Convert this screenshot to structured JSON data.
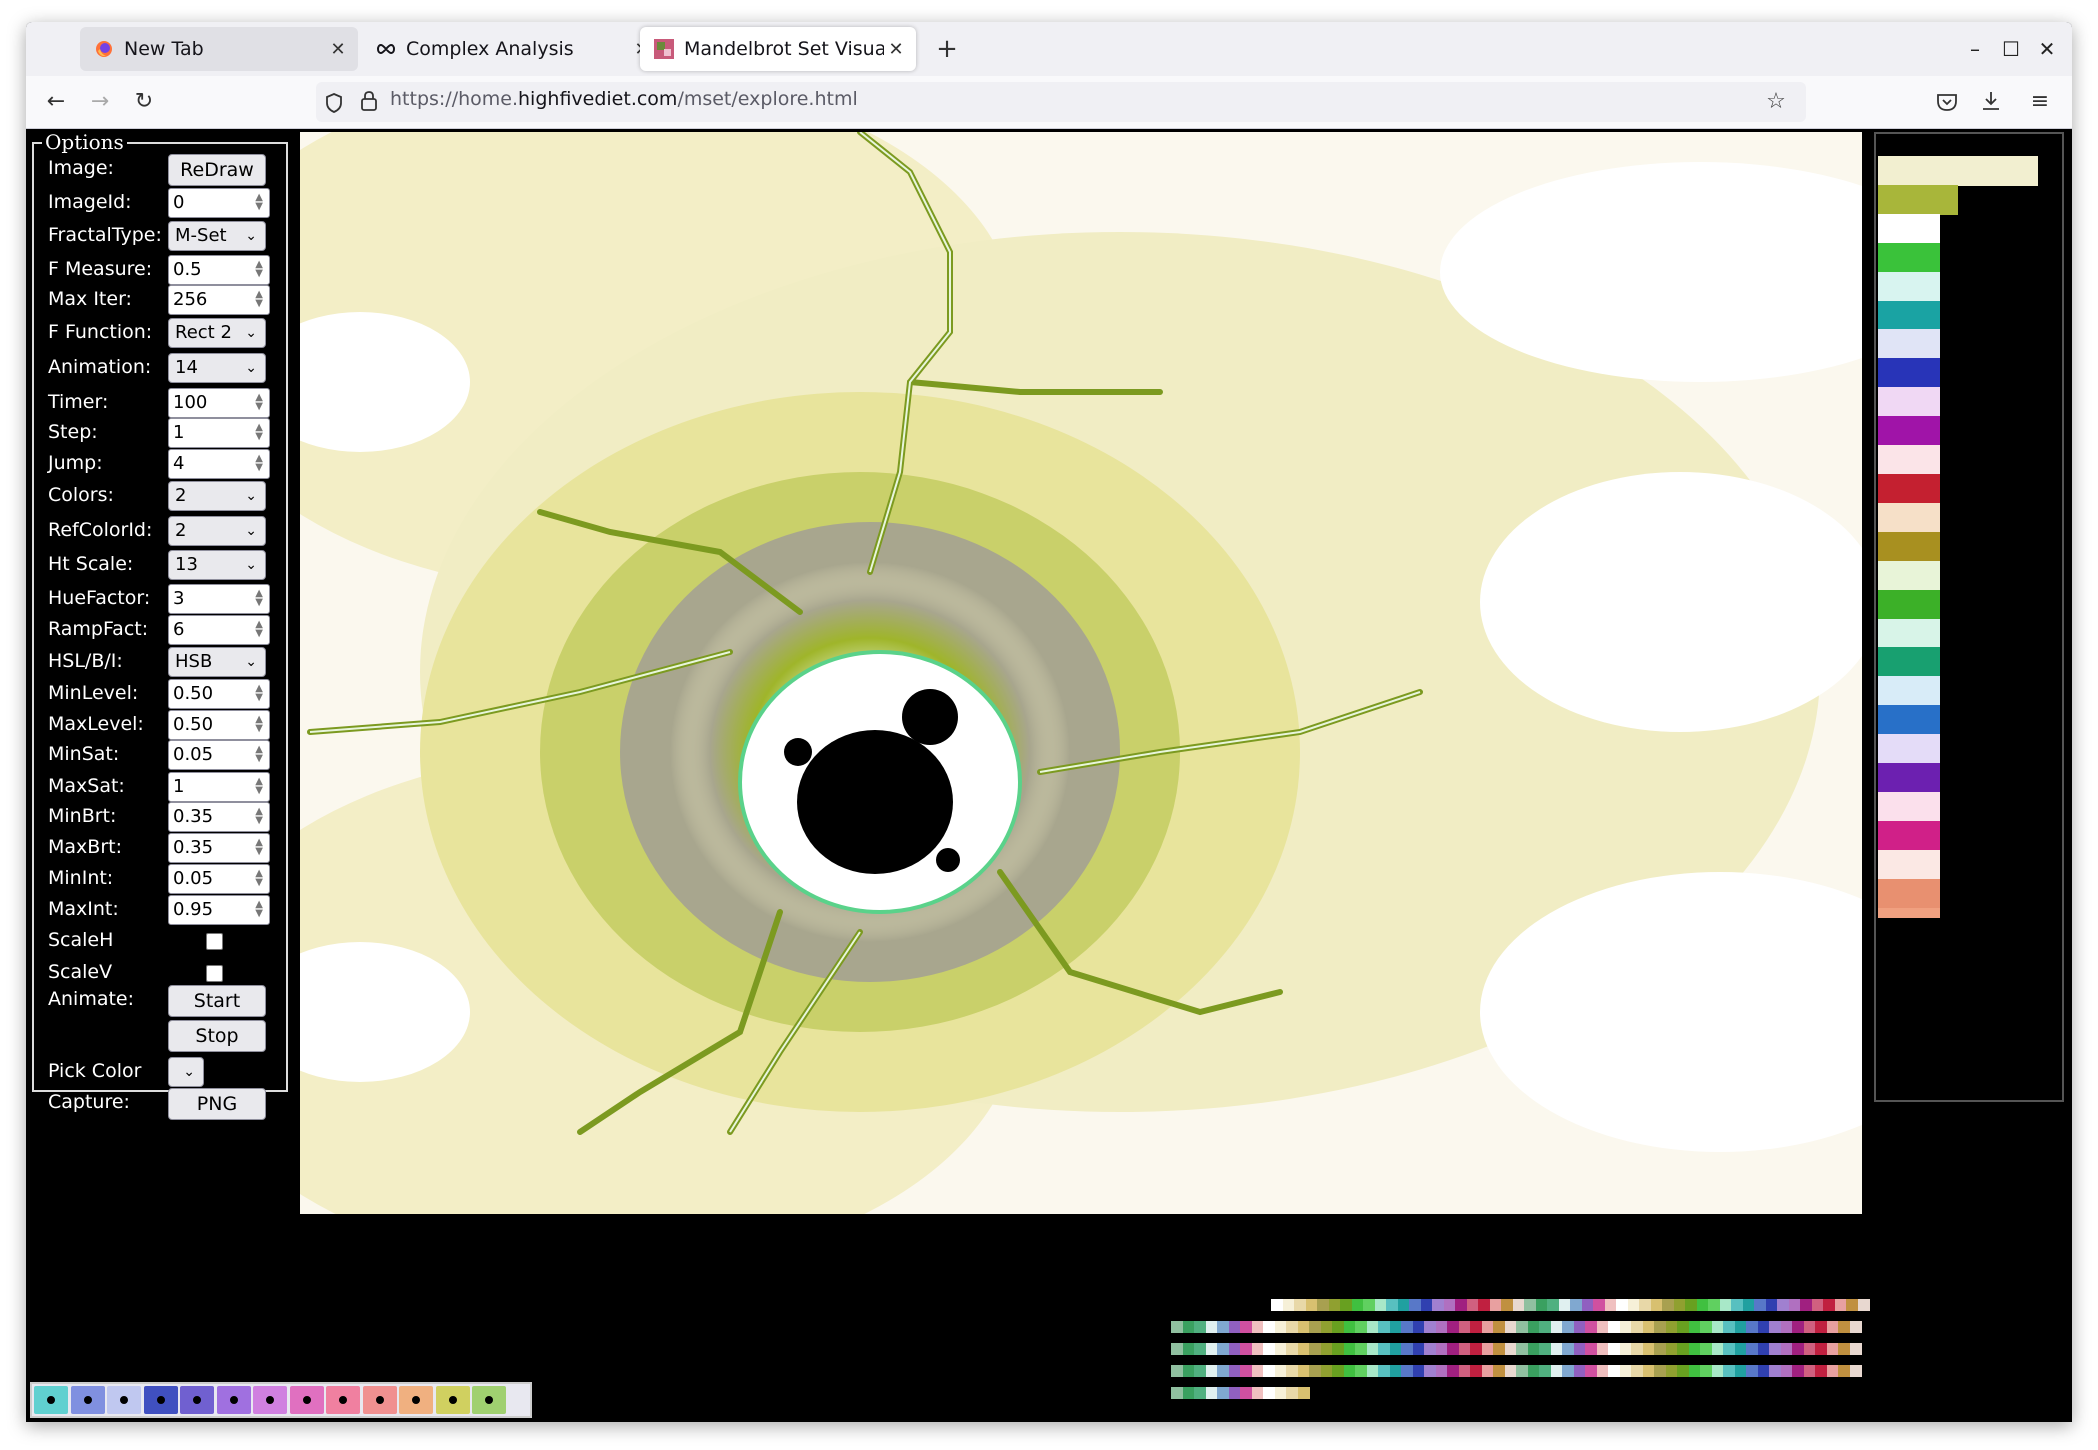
{
  "browser": {
    "tabs": [
      {
        "label": "New Tab",
        "icon": "firefox-icon"
      },
      {
        "label": "Complex Analysis",
        "icon": "infinity-icon"
      },
      {
        "label": "Mandelbrot Set Visualiza",
        "icon": "fractal-favicon-icon",
        "active": true
      }
    ],
    "url_prefix": "https://home.",
    "url_domain": "highfivediet.com",
    "url_path": "/mset/explore.html"
  },
  "options": {
    "legend": "Options",
    "rows": [
      {
        "label": "Image:",
        "kind": "button",
        "value": "ReDraw"
      },
      {
        "label": "ImageId:",
        "kind": "number",
        "value": "0"
      },
      {
        "label": "FractalType:",
        "kind": "select",
        "value": "M-Set"
      },
      {
        "label": "F Measure:",
        "kind": "number",
        "value": "0.5"
      },
      {
        "label": "Max Iter:",
        "kind": "number",
        "value": "256"
      },
      {
        "label": "F Function:",
        "kind": "select",
        "value": "Rect 2"
      },
      {
        "label": "Animation:",
        "kind": "select",
        "value": "14"
      },
      {
        "label": "Timer:",
        "kind": "number",
        "value": "100"
      },
      {
        "label": "Step:",
        "kind": "number",
        "value": "1"
      },
      {
        "label": "Jump:",
        "kind": "number",
        "value": "4"
      },
      {
        "label": "Colors:",
        "kind": "select",
        "value": "2"
      },
      {
        "label": "RefColorId:",
        "kind": "select",
        "value": "2"
      },
      {
        "label": "Ht Scale:",
        "kind": "select",
        "value": "13"
      },
      {
        "label": "HueFactor:",
        "kind": "number",
        "value": "3"
      },
      {
        "label": "RampFact:",
        "kind": "number",
        "value": "6"
      },
      {
        "label": "HSL/B/I:",
        "kind": "select",
        "value": "HSB"
      },
      {
        "label": "MinLevel:",
        "kind": "number",
        "value": "0.50"
      },
      {
        "label": "MaxLevel:",
        "kind": "number",
        "value": "0.50"
      },
      {
        "label": "MinSat:",
        "kind": "number",
        "value": "0.05"
      },
      {
        "label": "MaxSat:",
        "kind": "number",
        "value": "1"
      },
      {
        "label": "MinBrt:",
        "kind": "number",
        "value": "0.35"
      },
      {
        "label": "MaxBrt:",
        "kind": "number",
        "value": "0.35"
      },
      {
        "label": "MinInt:",
        "kind": "number",
        "value": "0.05"
      },
      {
        "label": "MaxInt:",
        "kind": "number",
        "value": "0.95"
      },
      {
        "label": "ScaleH",
        "kind": "checkbox",
        "checked": false
      },
      {
        "label": "ScaleV",
        "kind": "checkbox",
        "checked": false
      },
      {
        "label": "Animate:",
        "kind": "button",
        "value": "Start"
      },
      {
        "label": "",
        "kind": "button",
        "value": "Stop"
      },
      {
        "label": "Pick Color",
        "kind": "color-select",
        "value": ""
      },
      {
        "label": "Capture:",
        "kind": "button",
        "value": "PNG"
      }
    ]
  },
  "colors": {
    "set_interior": "#000000",
    "fractal_yellow_green": "#9fb52a",
    "fractal_gray": "#a8a68e",
    "fractal_pale": "#f3eec6",
    "histogram_bands": [
      "#f2efd0",
      "#a8b63a",
      "#ffffff",
      "#3ac23a",
      "#d8f4f0",
      "#1aa3a3",
      "#e0e4f6",
      "#2834b8",
      "#f0d8f4",
      "#a014a8",
      "#fbe4e8",
      "#c42030",
      "#f6e0c8",
      "#a89020",
      "#e8f4d8",
      "#3cb028",
      "#d8f4e8",
      "#18a070",
      "#d8ecf8",
      "#2870c8",
      "#e4dcf8",
      "#6c20b0",
      "#fbe0ec",
      "#d02088",
      "#fbe8e4",
      "#e89070"
    ]
  }
}
